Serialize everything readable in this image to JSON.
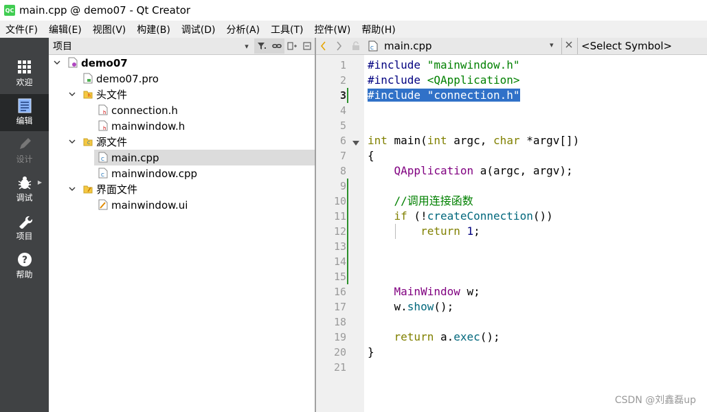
{
  "window": {
    "title": "main.cpp @ demo07 - Qt Creator",
    "logo": "QC"
  },
  "menu": [
    "文件(F)",
    "编辑(E)",
    "视图(V)",
    "构建(B)",
    "调试(D)",
    "分析(A)",
    "工具(T)",
    "控件(W)",
    "帮助(H)"
  ],
  "modes": [
    {
      "label": "欢迎",
      "icon": "grid-icon"
    },
    {
      "label": "编辑",
      "icon": "document-icon",
      "active": true
    },
    {
      "label": "设计",
      "icon": "pencil-icon",
      "disabled": true
    },
    {
      "label": "调试",
      "icon": "bug-icon"
    },
    {
      "label": "项目",
      "icon": "wrench-icon"
    },
    {
      "label": "帮助",
      "icon": "help-icon"
    }
  ],
  "project_panel": {
    "title": "项目"
  },
  "tree": [
    {
      "label": "demo07",
      "type": "project",
      "bold": true,
      "expanded": true
    },
    {
      "label": "demo07.pro",
      "type": "pro"
    },
    {
      "label": "头文件",
      "type": "folder-h",
      "expanded": true
    },
    {
      "label": "connection.h",
      "type": "h"
    },
    {
      "label": "mainwindow.h",
      "type": "h"
    },
    {
      "label": "源文件",
      "type": "folder-cpp",
      "expanded": true
    },
    {
      "label": "main.cpp",
      "type": "cpp",
      "selected": true
    },
    {
      "label": "mainwindow.cpp",
      "type": "cpp"
    },
    {
      "label": "界面文件",
      "type": "folder-ui",
      "expanded": true
    },
    {
      "label": "mainwindow.ui",
      "type": "ui"
    }
  ],
  "editor": {
    "filename": "main.cpp",
    "symbol": "<Select Symbol>",
    "current_line": 3
  },
  "code_lines": [
    "#include \"mainwindow.h\"",
    "#include <QApplication>",
    "#include \"connection.h\"",
    "",
    "",
    "int main(int argc, char *argv[])",
    "{",
    "    QApplication a(argc, argv);",
    "",
    "    //调用连接函数",
    "    if (!createConnection())",
    "        return 1;",
    "",
    "",
    "",
    "    MainWindow w;",
    "    w.show();",
    "",
    "    return a.exec();",
    "}",
    ""
  ],
  "watermark": "CSDN @刘鑫磊up"
}
